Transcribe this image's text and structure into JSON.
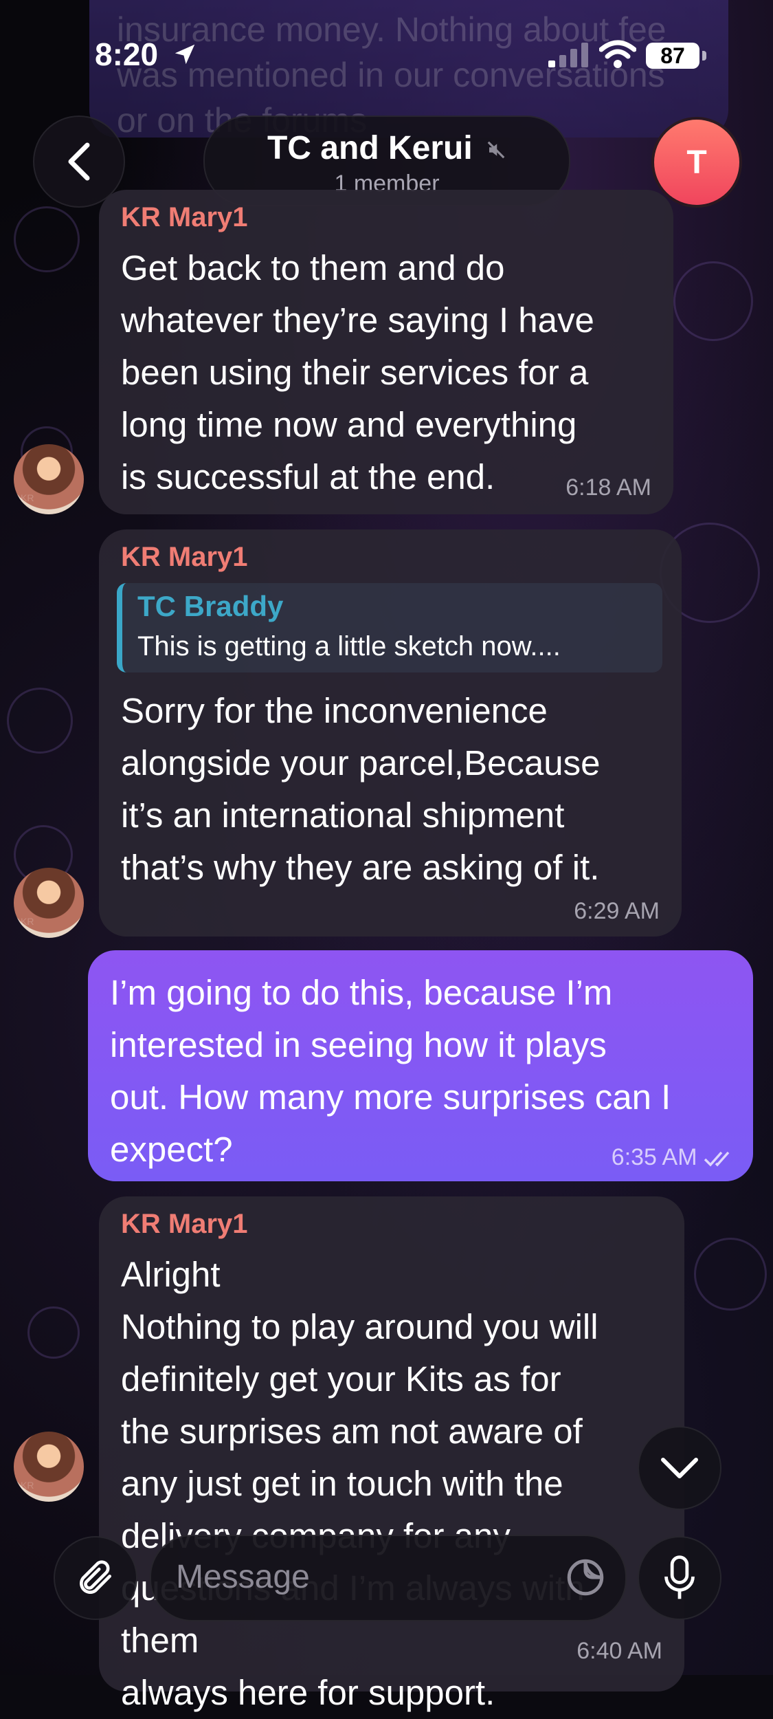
{
  "status_bar": {
    "time": "8:20",
    "battery": "87"
  },
  "header": {
    "title": "TC and Kerui",
    "subtitle": "1 member",
    "avatar_initial": "T"
  },
  "ghost_message": {
    "text": "insurance money. Nothing about fee was mentioned in our conversations or on the forums"
  },
  "messages": [
    {
      "sender": "KR Mary1",
      "text": "Get back to them and do\nwhatever they’re saying I have\nbeen using their services for a\nlong time now and everything\nis successful at the end.",
      "time": "6:18 AM"
    },
    {
      "sender": "KR Mary1",
      "reply_name": "TC Braddy",
      "reply_text": "This is getting a little sketch now....",
      "text": "Sorry for the inconvenience\nalongside your parcel,Because\nit’s an international shipment\nthat’s why they are asking of it.",
      "time": "6:29 AM"
    },
    {
      "outgoing": true,
      "text": "I’m going to do this, because I’m\ninterested in seeing how it plays\nout. How many more surprises can I\nexpect?",
      "time": "6:35 AM"
    },
    {
      "sender": "KR Mary1",
      "text": "Alright\nNothing to play around you will\ndefinitely get your Kits as for\nthe surprises am not aware of\nany just get in touch with the\ndelivery company for any\nquestions and I’m always with them\nalways here for support.",
      "time": "6:40 AM"
    }
  ],
  "composer": {
    "placeholder": "Message"
  },
  "colors": {
    "accent": "#7a5cf5",
    "sender": "#f07d74",
    "reply": "#3da8c8"
  }
}
